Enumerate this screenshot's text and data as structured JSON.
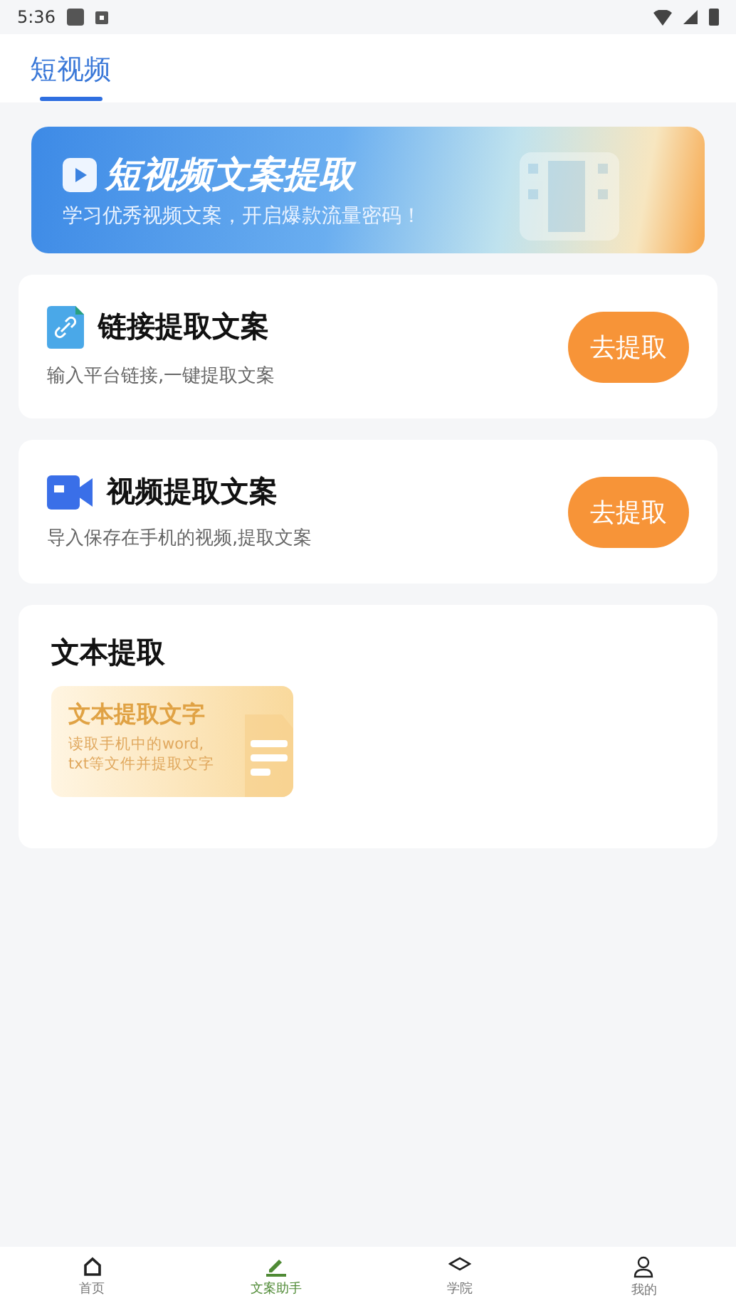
{
  "status_bar": {
    "time": "5:36"
  },
  "tabs": [
    {
      "label": "短视频",
      "selected": true
    }
  ],
  "banner": {
    "title": "短视频文案提取",
    "subtitle": "学习优秀视频文案，开启爆款流量密码！"
  },
  "cards": [
    {
      "kind": "link",
      "title": "链接提取文案",
      "description": "输入平台链接,一键提取文案",
      "button": "去提取"
    },
    {
      "kind": "video",
      "title": "视频提取文案",
      "description": "导入保存在手机的视频,提取文案",
      "button": "去提取"
    }
  ],
  "text_section": {
    "title": "文本提取",
    "tile_title": "文本提取文字",
    "tile_description": [
      "读取手机中的word,",
      "txt等文件并提取文字"
    ]
  },
  "bottom_nav": [
    {
      "kind": "home",
      "label": "首页",
      "selected": false
    },
    {
      "kind": "write",
      "label": "文案助手",
      "selected": true
    },
    {
      "kind": "school",
      "label": "学院",
      "selected": false
    },
    {
      "kind": "user",
      "label": "我的",
      "selected": false
    }
  ]
}
